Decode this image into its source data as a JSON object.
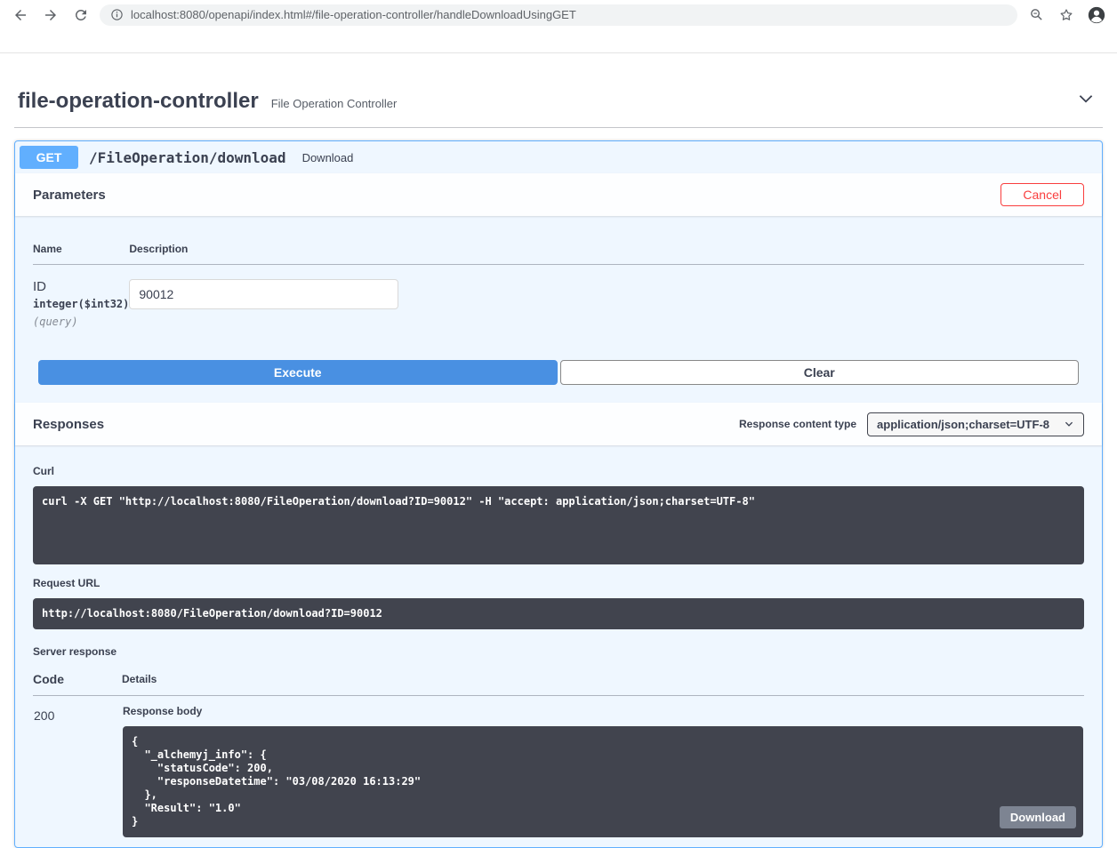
{
  "browser": {
    "url": "localhost:8080/openapi/index.html#/file-operation-controller/handleDownloadUsingGET"
  },
  "section": {
    "title": "file-operation-controller",
    "subtitle": "File Operation Controller"
  },
  "operation": {
    "method": "GET",
    "path": "/FileOperation/download",
    "summary": "Download"
  },
  "parameters": {
    "title": "Parameters",
    "cancel_label": "Cancel",
    "columns": {
      "name": "Name",
      "description": "Description"
    },
    "param": {
      "name": "ID",
      "type": "integer($int32)",
      "location": "(query)",
      "value": "90012"
    },
    "execute_label": "Execute",
    "clear_label": "Clear"
  },
  "responses": {
    "title": "Responses",
    "content_type_label": "Response content type",
    "content_type_value": "application/json;charset=UTF-8",
    "curl_label": "Curl",
    "curl_command": "curl -X GET \"http://localhost:8080/FileOperation/download?ID=90012\" -H \"accept: application/json;charset=UTF-8\"",
    "request_url_label": "Request URL",
    "request_url": "http://localhost:8080/FileOperation/download?ID=90012",
    "server_response_label": "Server response",
    "columns": {
      "code": "Code",
      "details": "Details"
    },
    "row": {
      "code": "200",
      "body_label": "Response body",
      "body": "{\n  \"_alchemyj_info\": {\n    \"statusCode\": 200,\n    \"responseDatetime\": \"03/08/2020 16:13:29\"\n  },\n  \"Result\": \"1.0\"\n}",
      "download_label": "Download"
    }
  }
}
